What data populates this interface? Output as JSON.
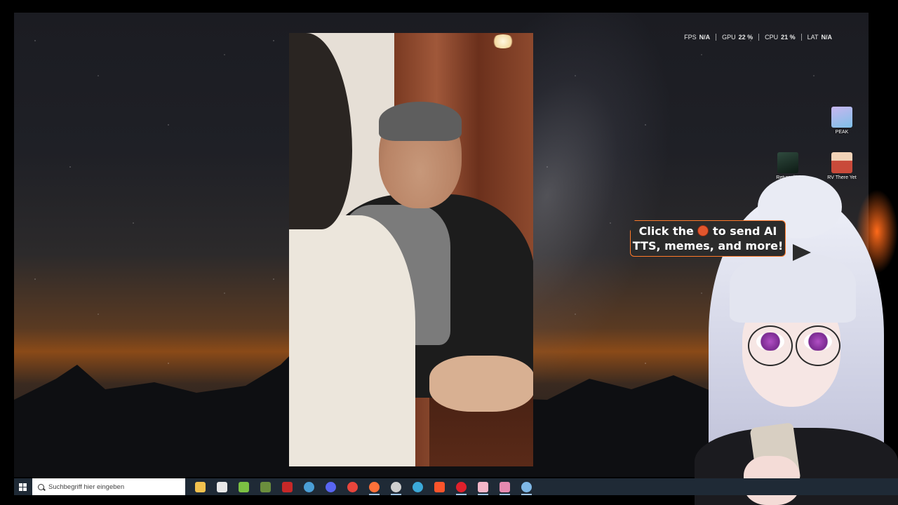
{
  "overlay": {
    "stats": [
      {
        "label": "FPS",
        "value": "N/A"
      },
      {
        "label": "GPU",
        "value": "22 %"
      },
      {
        "label": "CPU",
        "value": "21 %"
      },
      {
        "label": "LAT",
        "value": "N/A"
      }
    ]
  },
  "desktop": {
    "icons": [
      {
        "label": "PEAK",
        "color": "#b9a3e6"
      },
      {
        "label": "Returnal™",
        "color": "#2f4a3e"
      },
      {
        "label": "RV There Yet",
        "color": "#c94a3a"
      }
    ]
  },
  "bubble": {
    "line1_prefix": "Click the",
    "line1_suffix": "to send AI",
    "line2": "TTS, memes, and more!",
    "accent": "#ff7a2a"
  },
  "taskbar": {
    "search_placeholder": "Suchbegriff hier eingeben",
    "apps": [
      {
        "name": "file-explorer-icon",
        "color": "#f2c14e",
        "open": false
      },
      {
        "name": "store-icon",
        "color": "#e8e8e8",
        "open": false
      },
      {
        "name": "android-icon",
        "color": "#7bc043",
        "open": false
      },
      {
        "name": "minecraft-icon",
        "color": "#6b8e3d",
        "open": false
      },
      {
        "name": "game-launcher-icon",
        "color": "#c62828",
        "open": false
      },
      {
        "name": "steam-icon",
        "color": "#4a9ed6",
        "open": false
      },
      {
        "name": "discord-icon",
        "color": "#5865f2",
        "open": false
      },
      {
        "name": "chrome-icon",
        "color": "#e8453c",
        "open": false
      },
      {
        "name": "firefox-icon",
        "color": "#ff7139",
        "open": true
      },
      {
        "name": "obs-icon",
        "color": "#cfcfcf",
        "open": true
      },
      {
        "name": "edge-icon",
        "color": "#3ba9d9",
        "open": false
      },
      {
        "name": "brave-icon",
        "color": "#fb542b",
        "open": false
      },
      {
        "name": "opera-icon",
        "color": "#e0202b",
        "open": true
      },
      {
        "name": "vtuber-app-icon",
        "color": "#f4b6c8",
        "open": true
      },
      {
        "name": "sword-game-icon",
        "color": "#e58ab0",
        "open": true
      },
      {
        "name": "steam-tray-icon",
        "color": "#7fb8e6",
        "open": true
      }
    ]
  }
}
